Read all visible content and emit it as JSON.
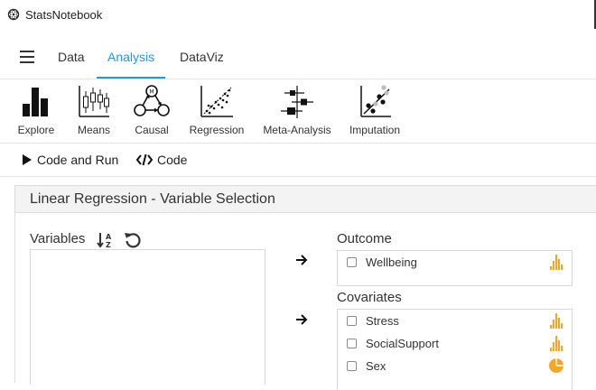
{
  "window": {
    "title": "StatsNotebook"
  },
  "menu": {
    "tabs": [
      {
        "label": "Data"
      },
      {
        "label": "Analysis"
      },
      {
        "label": "DataViz"
      }
    ],
    "active_tab": "Analysis",
    "accent_color": "#2196f3"
  },
  "toolbar": {
    "items": [
      {
        "label": "Explore",
        "icon": "bar-chart-icon"
      },
      {
        "label": "Means",
        "icon": "candlestick-icon"
      },
      {
        "label": "Causal",
        "icon": "causal-graph-icon"
      },
      {
        "label": "Regression",
        "icon": "scatter-regression-icon"
      },
      {
        "label": "Meta-Analysis",
        "icon": "forest-plot-icon"
      },
      {
        "label": "Imputation",
        "icon": "imputation-scatter-icon"
      }
    ]
  },
  "actions": {
    "code_and_run": "Code and Run",
    "code": "Code"
  },
  "panel": {
    "title": "Linear Regression - Variable Selection",
    "variables_label": "Variables",
    "variables": [],
    "outcome": {
      "label": "Outcome",
      "items": [
        {
          "name": "Wellbeing",
          "type": "numeric"
        }
      ]
    },
    "covariates": {
      "label": "Covariates",
      "items": [
        {
          "name": "Stress",
          "type": "numeric"
        },
        {
          "name": "SocialSupport",
          "type": "numeric"
        },
        {
          "name": "Sex",
          "type": "factor"
        }
      ]
    },
    "distribution_icon_color": "#f5a623"
  }
}
